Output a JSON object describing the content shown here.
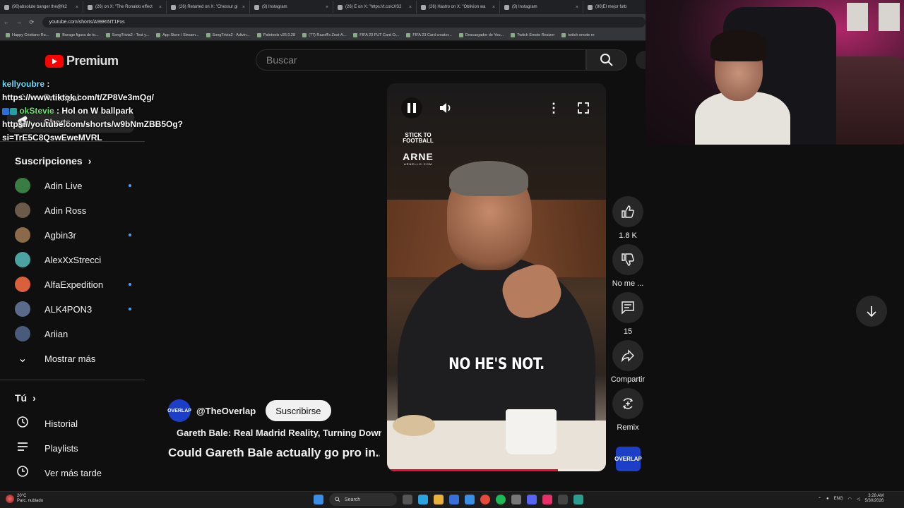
{
  "browser": {
    "tabs": [
      "(90)absolute banger the@fk2",
      "(26) on X: \"The Ronaldo effect",
      "(26) Retarted on X: \"Chessur gi",
      "(9) Instagram",
      "(26) E on X: \"https://t.co/cXS2",
      "(26) Hastro on X: \"Oblivion wa",
      "(9) Instagram",
      "(90)El mejor futb"
    ],
    "url": "youtube.com/shorts/A99RINT1Fxs",
    "bookmarks": [
      "Happy Cristiano Ro...",
      "Burago figura de to...",
      "SongTrivia2 - Test y...",
      "App Store / Stream...",
      "SongTrivia2 - Adivin...",
      "Paletools v26.0.28",
      "(77) Razoff's Zest-A...",
      "FIFA 23 FUT Card Cr...",
      "FIFA 23 Card creator...",
      "Descargador de You...",
      "Twitch Emote Resizer",
      "twitch emote re"
    ]
  },
  "sidebar": {
    "logo_text": "Premium",
    "nav": [
      {
        "label": "Principal",
        "icon": "home-icon"
      },
      {
        "label": "Shorts",
        "icon": "shorts-icon"
      }
    ],
    "subscriptions_title": "Suscripciones",
    "subscriptions": [
      {
        "name": "Adin Live",
        "new": true,
        "color": "#3a7d44"
      },
      {
        "name": "Adin Ross",
        "new": false,
        "color": "#6b5a4a"
      },
      {
        "name": "Agbin3r",
        "new": true,
        "color": "#8a6a4a"
      },
      {
        "name": "AlexXxStrecci",
        "new": false,
        "color": "#4aa3a0"
      },
      {
        "name": "AlfaExpedition",
        "new": true,
        "color": "#d9603a"
      },
      {
        "name": "ALK4PON3",
        "new": true,
        "color": "#5a6a8a"
      },
      {
        "name": "Ariian",
        "new": false,
        "color": "#4a5a7a"
      }
    ],
    "show_more": "Mostrar más",
    "you_title": "Tú",
    "you_items": [
      {
        "label": "Historial",
        "icon": "history-icon"
      },
      {
        "label": "Playlists",
        "icon": "playlists-icon"
      },
      {
        "label": "Ver más tarde",
        "icon": "watch-later-icon"
      }
    ]
  },
  "chat": [
    {
      "user": "kellyoubre",
      "msg": "https://www.tiktok.com/t/ZP8Ve3mQg/"
    },
    {
      "user": "okStevie",
      "msg": "Hol on W ballpark https://youtube.com/shorts/w9bNmZBB5Og?si=TrE5C8QswEweMVRL"
    }
  ],
  "search": {
    "placeholder": "Buscar"
  },
  "video": {
    "brand_top": "STICK TO FOOTBALL",
    "brand_name": "ARNE",
    "brand_sub": "ARNELLO.COM",
    "caption": "NO HE'S NOT.",
    "progress": 0.78
  },
  "actions": {
    "likes": "1.8 K",
    "dislike_label": "No me ...",
    "comments": "15",
    "share_label": "Compartir",
    "remix_label": "Remix",
    "channel_badge": "OVERLAP"
  },
  "meta": {
    "channel_badge": "OVERLAP",
    "handle": "@TheOverlap",
    "subscribe_label": "Suscribirse",
    "playlist": "Gareth Bale: Real Madrid Reality, Turning Down ...",
    "title": "Could Gareth Bale actually go pro in..."
  },
  "taskbar": {
    "temp": "20°C",
    "weather": "Parc. nublado",
    "search_label": "Search",
    "lang": "ENG",
    "time": "3:28 AM",
    "date": "5/30/2026"
  }
}
